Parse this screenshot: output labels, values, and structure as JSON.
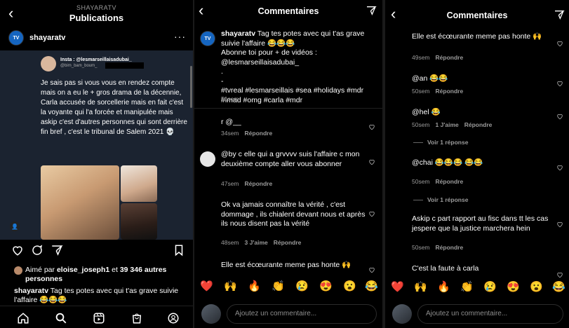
{
  "panel1": {
    "header": {
      "subtitle": "SHAYARATV",
      "title": "Publications"
    },
    "author": {
      "username": "shayaratv",
      "avatar_text": "TV",
      "more": "···"
    },
    "post": {
      "tweet_name": "Insta : @lesmarseillaisadubai_",
      "tweet_handle": "@bim_bam_boum_",
      "text": "Je sais pas si vous vous en rendez compte mais on a eu le + gros drama de la décennie, Carla accusée de sorcellerie mais en fait c'est la voyante qui l'a forcée et manipulée mais askip c'est d'autres personnes qui sont derrière fin bref , c'est le tribunal de Salem 2021 💀"
    },
    "likes": {
      "prefix": "Aimé par ",
      "user": "eloise_joseph1",
      "mid": " et ",
      "count": "39 346 autres personnes"
    },
    "caption": {
      "user": "shayaratv",
      "text": " Tag tes potes avec qui t'as grave suivie l'affaire 😂😂😂"
    },
    "icons": {
      "like": "heart-icon",
      "comment": "comment-icon",
      "share": "send-icon",
      "save": "bookmark-icon",
      "home": "home-icon",
      "search": "search-icon",
      "reels": "reels-icon",
      "shop": "shop-icon",
      "profile": "profile-icon"
    }
  },
  "panel2": {
    "title": "Commentaires",
    "caption": {
      "user": "shayaratv",
      "line1": " Tag tes potes avec qui t'as grave suivie l'affaire 😂😂😂",
      "line2": "Abonne toi pour + de vidéos : @lesmarseillaisadubai_",
      "line3": ".",
      "line4": "-",
      "tags": "#tvreal #lesmarseillais #sea #holidays #mdr #lmad #omg #carla #mdr",
      "time": "51sem"
    },
    "comments": [
      {
        "text": "r                        @__",
        "time": "34sem",
        "likes": "",
        "reply": "Répondre"
      },
      {
        "text": "          @by            c elle qui a grvvvv suis l'affaire c mon deuxième compte aller vous abonner",
        "time": "47sem",
        "likes": "",
        "reply": "Répondre"
      },
      {
        "text": "                       Ok va jamais connaître la vérité , c'est dommage , ils chialent devant nous et après ils nous disent pas la vérité",
        "time": "48sem",
        "likes": "3 J'aime",
        "reply": "Répondre"
      },
      {
        "text": "                Elle est écœurante meme pas honte 🙌",
        "time": "",
        "likes": "",
        "reply": ""
      }
    ],
    "emojis": [
      "❤️",
      "🙌",
      "🔥",
      "👏",
      "😢",
      "😍",
      "😮",
      "😂"
    ],
    "input_placeholder": "Ajoutez un commentaire..."
  },
  "panel3": {
    "title": "Commentaires",
    "comments": [
      {
        "text": "                 Elle est écœurante meme pas honte 🙌",
        "time": "49sem",
        "likes": "",
        "reply": "Répondre"
      },
      {
        "text": "                @an                  😂😂",
        "time": "50sem",
        "likes": "",
        "reply": "Répondre"
      },
      {
        "text": "        @hel                      😂",
        "time": "50sem",
        "likes": "1 J'aime",
        "reply": "Répondre",
        "view_replies": "Voir 1 réponse"
      },
      {
        "text": "               @chai                    😂😂😂 😂😂",
        "time": "50sem",
        "likes": "",
        "reply": "Répondre",
        "view_replies": "Voir 1 réponse"
      },
      {
        "text": "         Askip c part rapport au fisc dans tt les cas jespere que la justice marchera hein",
        "time": "50sem",
        "likes": "",
        "reply": "Répondre"
      },
      {
        "text": "                       C'est la faute à carla",
        "time": "",
        "likes": "",
        "reply": ""
      }
    ],
    "emojis": [
      "❤️",
      "🙌",
      "🔥",
      "👏",
      "😢",
      "😍",
      "😮",
      "😂"
    ],
    "input_placeholder": "Ajoutez un commentaire..."
  }
}
